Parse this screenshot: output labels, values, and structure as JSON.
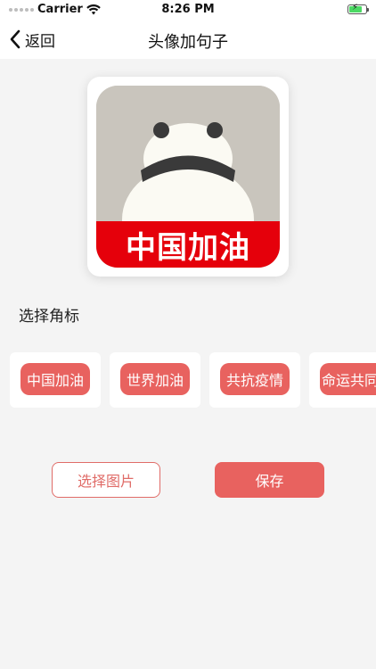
{
  "status_bar": {
    "carrier": "Carrier",
    "time": "8:26 PM",
    "battery_level": 0.75,
    "charging": true
  },
  "nav": {
    "back_label": "返回",
    "title": "头像加句子"
  },
  "preview": {
    "badge_text": "中国加油",
    "badge_color": "#e5000b"
  },
  "section": {
    "title": "选择角标"
  },
  "badges": [
    {
      "label": "中国加油"
    },
    {
      "label": "世界加油"
    },
    {
      "label": "共抗疫情"
    },
    {
      "label": "命运共同体"
    }
  ],
  "actions": {
    "select_image": "选择图片",
    "save": "保存"
  },
  "colors": {
    "accent": "#e8625f",
    "background": "#f4f4f4"
  }
}
